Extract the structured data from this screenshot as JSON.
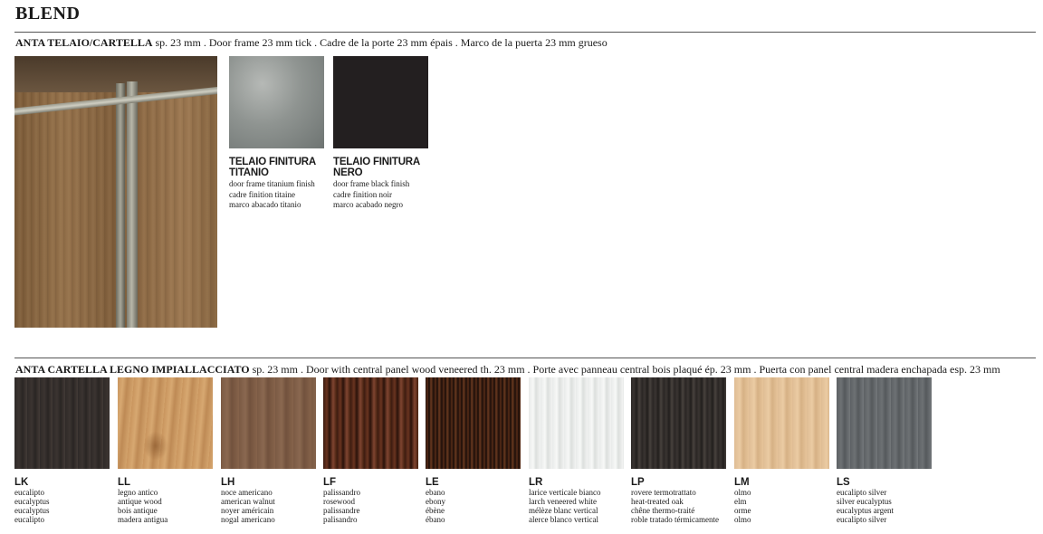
{
  "title": "BLEND",
  "section1": {
    "heading_bold": "ANTA TELAIO/CARTELLA",
    "heading_rest": " sp. 23 mm . Door frame 23 mm tick . Cadre de la porte 23 mm épais . Marco de la puerta 23 mm grueso"
  },
  "finishes": [
    {
      "name_line1": "TELAIO FINITURA",
      "name_line2": "TITANIO",
      "en": "door frame titanium finish",
      "fr": "cadre finition titaine",
      "es": "marco abacado titanio",
      "color": "#8f9491"
    },
    {
      "name_line1": "TELAIO FINITURA",
      "name_line2": "NERO",
      "en": "door frame black finish",
      "fr": "cadre finition noir",
      "es": "marco acabado negro",
      "color": "#231f20"
    }
  ],
  "section2": {
    "heading_bold": "ANTA CARTELLA LEGNO IMPIALLACCIATO",
    "heading_rest": " sp. 23 mm . Door with central panel wood veneered th. 23 mm . Porte avec panneau central bois plaqué ép. 23 mm . Puerta con panel central madera enchapada esp. 23 mm"
  },
  "woods": [
    {
      "code": "LK",
      "it": "eucalipto",
      "en": "eucalyptus",
      "fr": "eucalyptus",
      "es": "eucalipto",
      "color": "#352f2c"
    },
    {
      "code": "LL",
      "it": "legno antico",
      "en": "antique wood",
      "fr": "bois antique",
      "es": "madera antigua",
      "color": "#cf9d66"
    },
    {
      "code": "LH",
      "it": "noce americano",
      "en": "american walnut",
      "fr": "noyer américain",
      "es": "nogal americano",
      "color": "#7f5f48"
    },
    {
      "code": "LF",
      "it": "palissandro",
      "en": "rosewood",
      "fr": "palissandre",
      "es": "palisandro",
      "color": "#5a2a18"
    },
    {
      "code": "LE",
      "it": "ebano",
      "en": "ebony",
      "fr": "ébène",
      "es": "ébano",
      "color": "#2a150c"
    },
    {
      "code": "LR",
      "it": "larice verticale bianco",
      "en": "larch veneered white",
      "fr": "mélèze blanc vertical",
      "es": "alerce blanco vertical",
      "color": "#eceeed"
    },
    {
      "code": "LP",
      "it": "rovere termotrattato",
      "en": "heat-treated oak",
      "fr": "chêne thermo-traité",
      "es": "roble tratado térmicamente",
      "color": "#312c29"
    },
    {
      "code": "LM",
      "it": "olmo",
      "en": "elm",
      "fr": "orme",
      "es": "olmo",
      "color": "#e2c096"
    },
    {
      "code": "LS",
      "it": "eucalipto silver",
      "en": "silver eucalyptus",
      "fr": "eucalyptus argent",
      "es": "eucalipto silver",
      "color": "#65696c"
    }
  ]
}
